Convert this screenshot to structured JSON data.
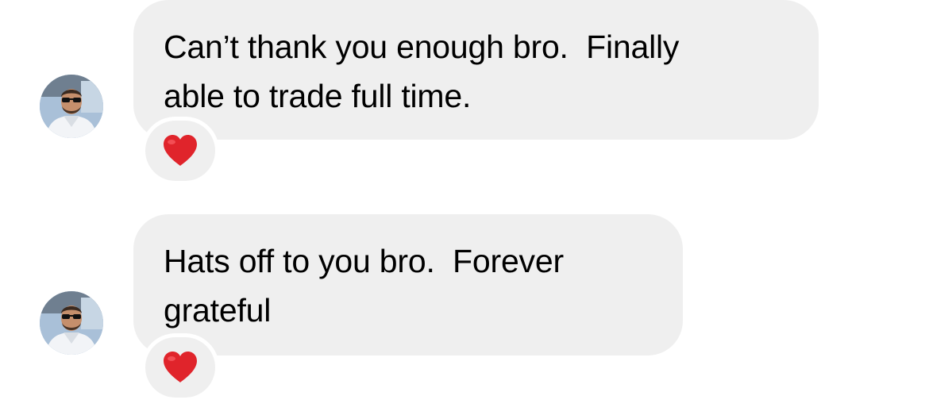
{
  "messages": [
    {
      "lines": [
        "Can’t thank you enough bro.  Finally",
        "able to trade full time."
      ],
      "reaction": "red-heart",
      "avatar": "profile-photo-man-sunglasses"
    },
    {
      "lines": [
        "Hats off to you bro.  Forever",
        "grateful"
      ],
      "reaction": "red-heart",
      "avatar": "profile-photo-man-sunglasses"
    }
  ],
  "colors": {
    "bubble": "#efefef",
    "heart": "#e0242b",
    "text": "#000000"
  }
}
